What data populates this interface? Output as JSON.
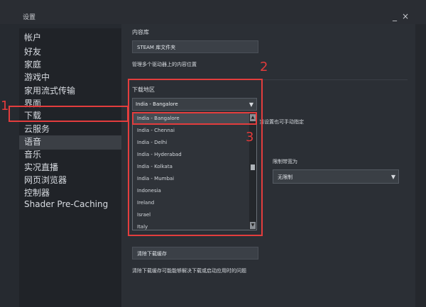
{
  "window": {
    "title": "设置",
    "min_icon": "_",
    "close_icon": "×"
  },
  "sidebar": {
    "items": [
      "帐户",
      "好友",
      "家庭",
      "游戏中",
      "家用流式传输",
      "界面",
      "下载",
      "云服务",
      "语音",
      "音乐",
      "实况直播",
      "网页浏览器",
      "控制器",
      "Shader Pre-Caching"
    ],
    "selected": "下载"
  },
  "content_library": {
    "heading": "内容库",
    "button": "STEAM 库文件夹",
    "desc": "管理多个驱动器上的内容位置"
  },
  "download_region": {
    "heading": "下载地区",
    "selected": "India - Bangalore",
    "note": "当设置也可手动指定",
    "options": [
      "India - Bangalore",
      "India - Chennai",
      "India - Delhi",
      "India - Hyderabad",
      "India - Kolkata",
      "India - Mumbai",
      "Indonesia",
      "Ireland",
      "Israel",
      "Italy"
    ]
  },
  "bandwidth": {
    "label": "限制带宽为",
    "value": "无限制"
  },
  "cache": {
    "button": "清除下载缓存",
    "desc": "清除下载缓存可能能够解决下载或启动应用时的问题"
  },
  "annotations": [
    "1",
    "2",
    "3"
  ],
  "colors": {
    "accent_red": "#e33d3d"
  }
}
